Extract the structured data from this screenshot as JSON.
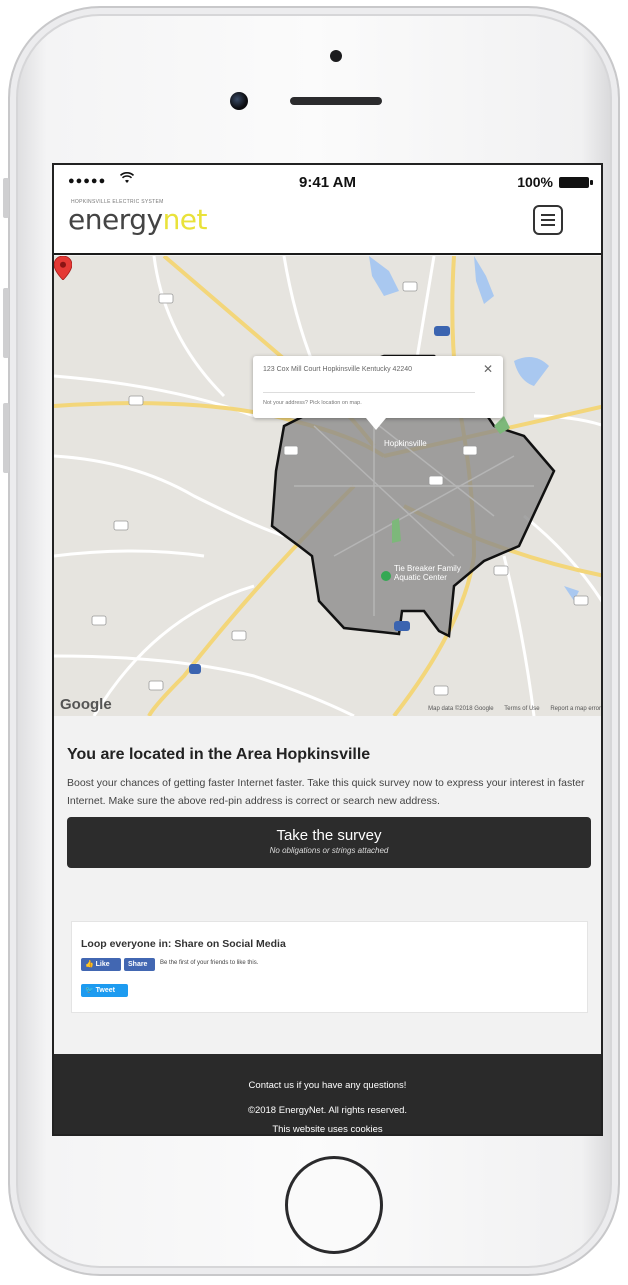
{
  "status_bar": {
    "signal": "●●●●●",
    "time": "9:41 AM",
    "battery": "100%"
  },
  "header": {
    "logo_tagline": "HOPKINSVILLE ELECTRIC SYSTEM",
    "logo_part1": "energy",
    "logo_part2": "net"
  },
  "map": {
    "info_window": {
      "address": "123 Cox Mill Court Hopkinsville Kentucky 42240",
      "close": "✕",
      "link": "Not your address? Pick location on map."
    },
    "place_label": "Hopkinsville",
    "park_label_line1": "Tie Breaker Family",
    "park_label_line2": "Aquatic Center",
    "google": "Google",
    "footer_items": [
      "Map data ©2018 Google",
      "Terms of Use",
      "Report a map error"
    ]
  },
  "main": {
    "headline": "You are located in the Area Hopkinsville",
    "description": "Boost your chances of getting faster Internet faster. Take this quick survey now to express your interest in faster Internet. Make sure the above red-pin address is correct or search new address.",
    "survey_title": "Take the survey",
    "survey_subtitle": "No obligations or strings attached"
  },
  "share": {
    "title": "Loop everyone in: Share on Social Media",
    "like": "👍 Like",
    "share": "Share",
    "fb_text": "Be the first of your friends to like this.",
    "tweet": "🐦 Tweet"
  },
  "footer": {
    "contact": "Contact us if you have any questions!",
    "copyright": "©2018 EnergyNet. All rights reserved.",
    "cookies": "This website uses cookies"
  },
  "colors": {
    "brand_yellow": "#e9e23a",
    "dark_button": "#2c2c2c",
    "facebook": "#4267b2",
    "twitter": "#1d9bf0",
    "pin_red": "#e53935"
  }
}
